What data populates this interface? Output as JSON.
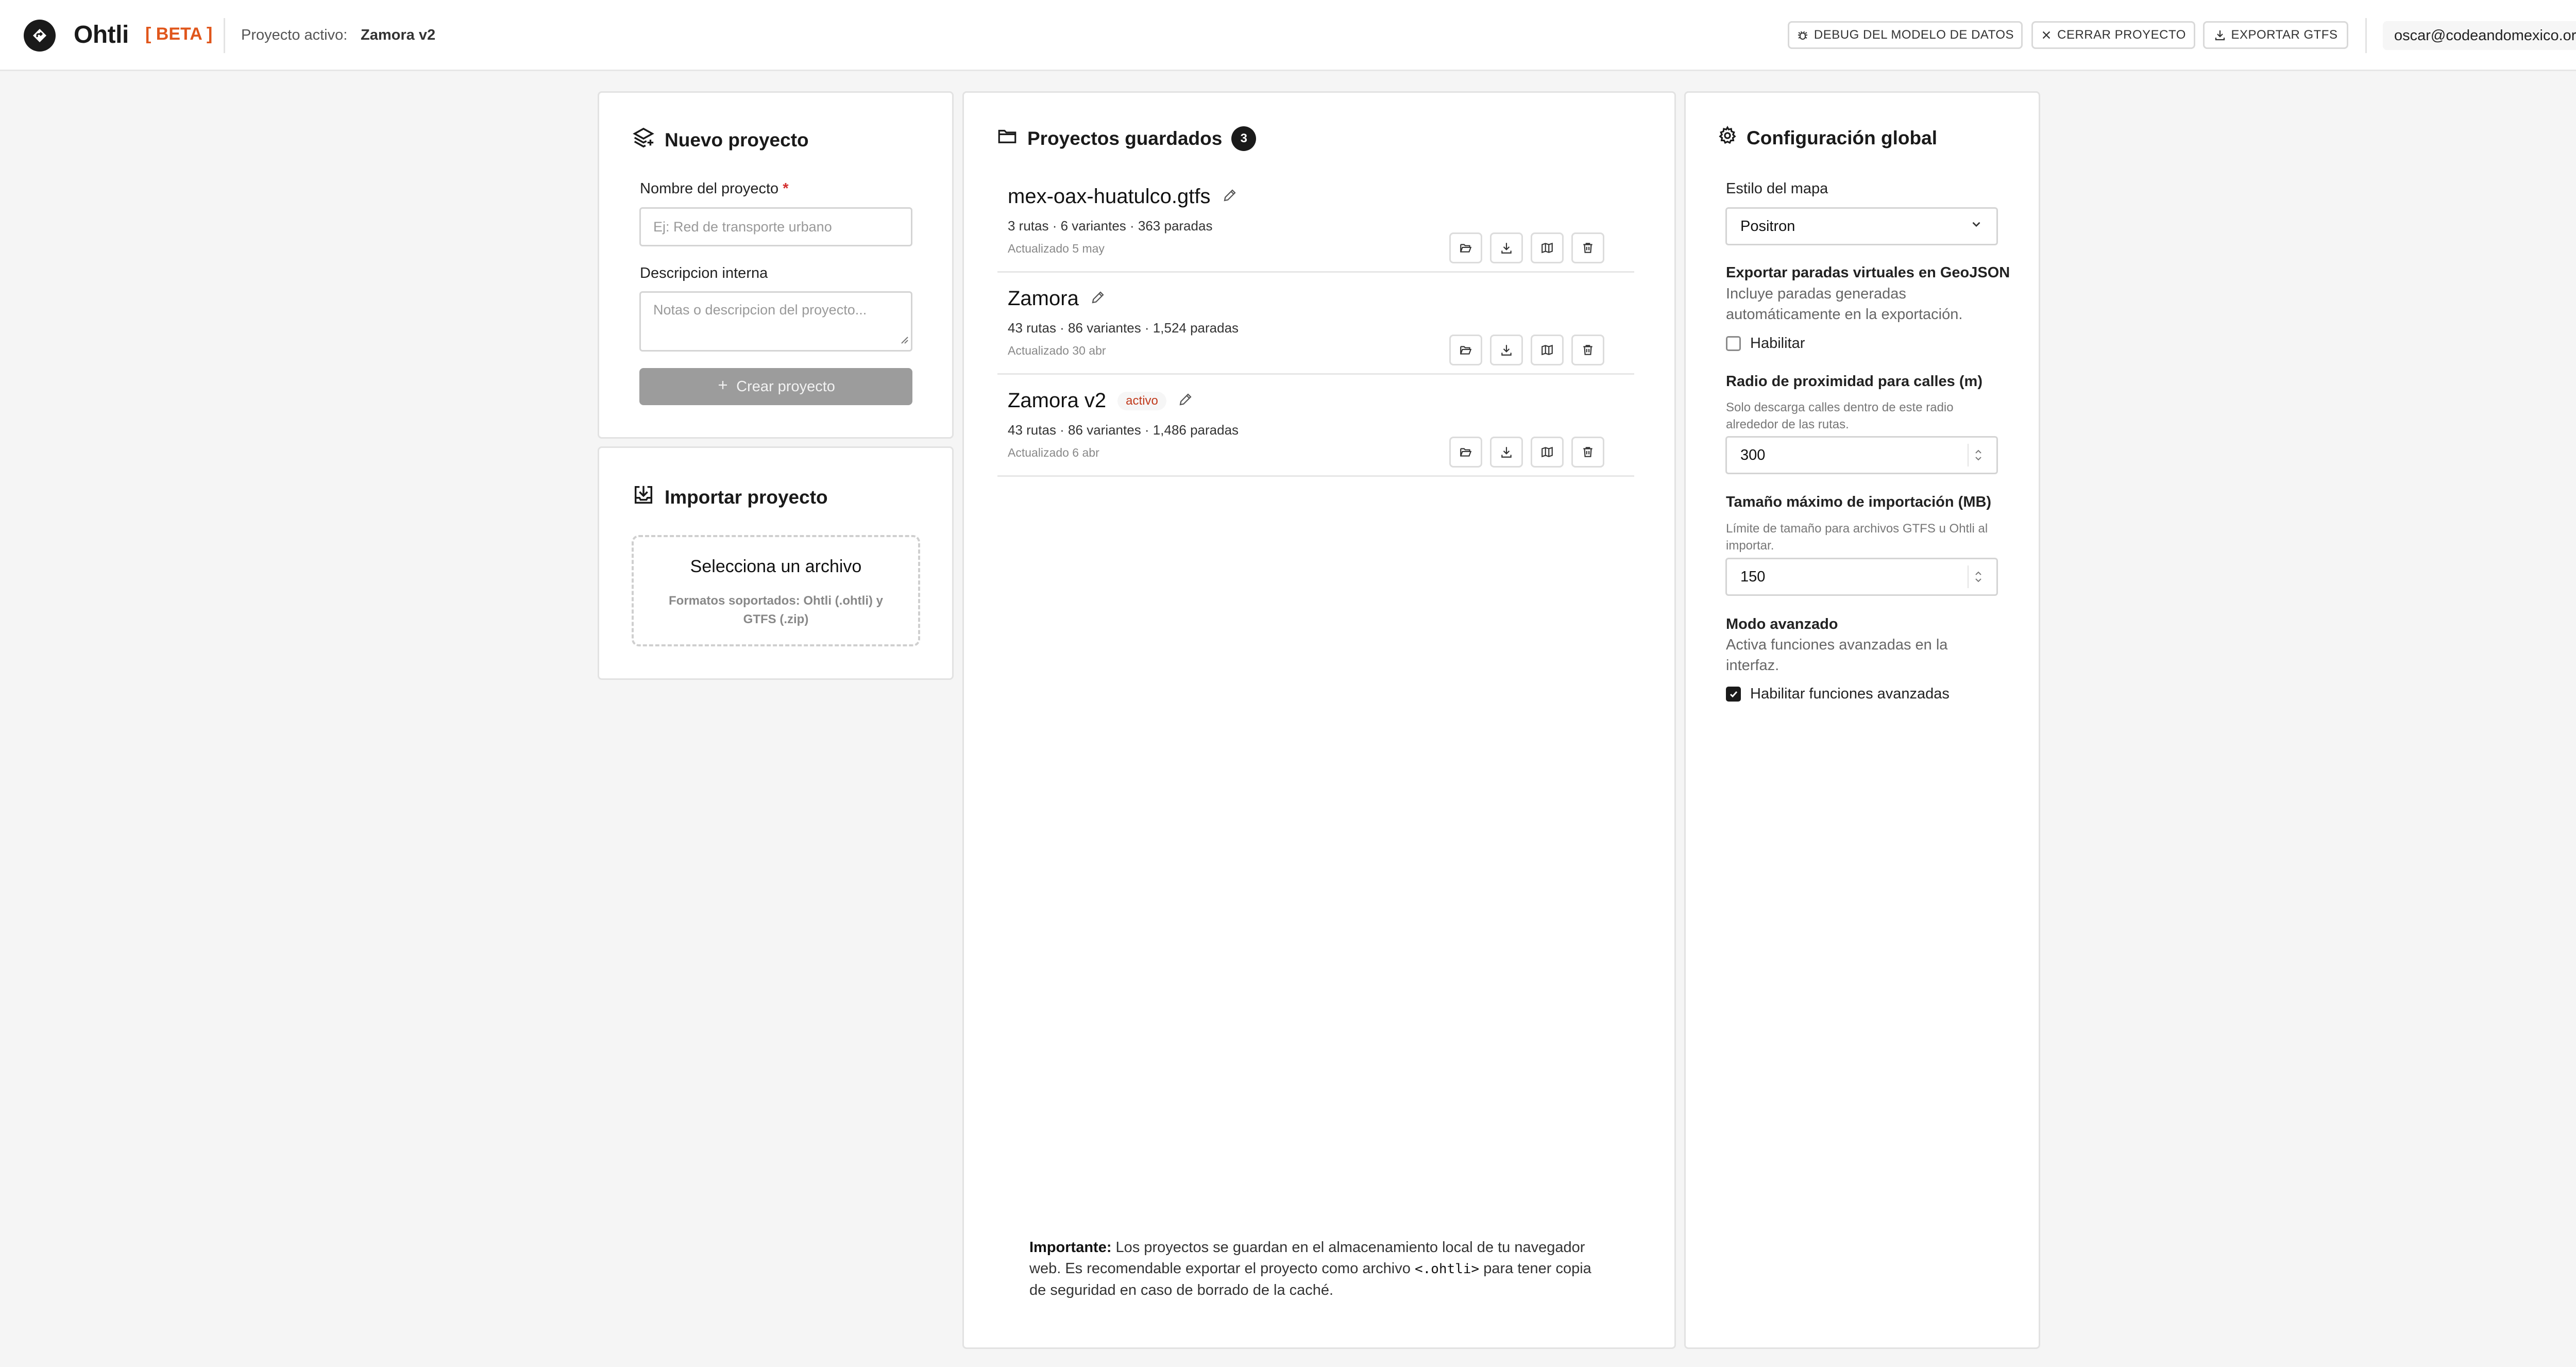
{
  "header": {
    "app_name": "Ohtli",
    "beta": "[ BETA ]",
    "active_project_label": "Proyecto activo:",
    "active_project_name": "Zamora v2",
    "debug_button": "DEBUG DEL MODELO DE DATOS",
    "close_button": "CERRAR PROYECTO",
    "export_button": "EXPORTAR GTFS",
    "user_email": "oscar@codeandomexico.org"
  },
  "new_project": {
    "title": "Nuevo proyecto",
    "name_label": "Nombre del proyecto",
    "required_mark": "*",
    "name_placeholder": "Ej: Red de transporte urbano",
    "description_label": "Descripcion interna",
    "description_placeholder": "Notas o descripcion del proyecto...",
    "create_button": "Crear proyecto"
  },
  "import_project": {
    "title": "Importar proyecto",
    "select_file": "Selecciona un archivo",
    "formats": "Formatos soportados: Ohtli (.ohtli) y GTFS (.zip)"
  },
  "saved_projects": {
    "title": "Proyectos guardados",
    "count": "3",
    "items": [
      {
        "name": "mex-oax-huatulco.gtfs",
        "meta": "3 rutas · 6 variantes · 363 paradas",
        "updated": "Actualizado 5 may",
        "badge": ""
      },
      {
        "name": "Zamora",
        "meta": "43 rutas · 86 variantes · 1,524 paradas",
        "updated": "Actualizado 30 abr",
        "badge": ""
      },
      {
        "name": "Zamora v2",
        "meta": "43 rutas · 86 variantes · 1,486 paradas",
        "updated": "Actualizado 6 abr",
        "badge": "activo"
      }
    ],
    "note_strong": "Importante:",
    "note_text_1": " Los proyectos se guardan en el almacenamiento local de tu navegador web. Es recomendable exportar el proyecto como archivo ",
    "note_code": "<.ohtli>",
    "note_text_2": " para tener copia de seguridad en caso de borrado de la caché."
  },
  "global_config": {
    "title": "Configuración global",
    "map_style_label": "Estilo del mapa",
    "map_style_value": "Positron",
    "export_virtual_label": "Exportar paradas virtuales en GeoJSON",
    "export_virtual_desc": "Incluye paradas generadas automáticamente en la exportación.",
    "export_virtual_checkbox": "Habilitar",
    "export_virtual_checked": false,
    "radius_label": "Radio de proximidad para calles (m)",
    "radius_desc": "Solo descarga calles dentro de este radio alrededor de las rutas.",
    "radius_value": "300",
    "max_size_label": "Tamaño máximo de importación (MB)",
    "max_size_desc": "Límite de tamaño para archivos GTFS u Ohtli al importar.",
    "max_size_value": "150",
    "advanced_label": "Modo avanzado",
    "advanced_desc": "Activa funciones avanzadas en la interfaz.",
    "advanced_checkbox": "Habilitar funciones avanzadas",
    "advanced_checked": true
  }
}
